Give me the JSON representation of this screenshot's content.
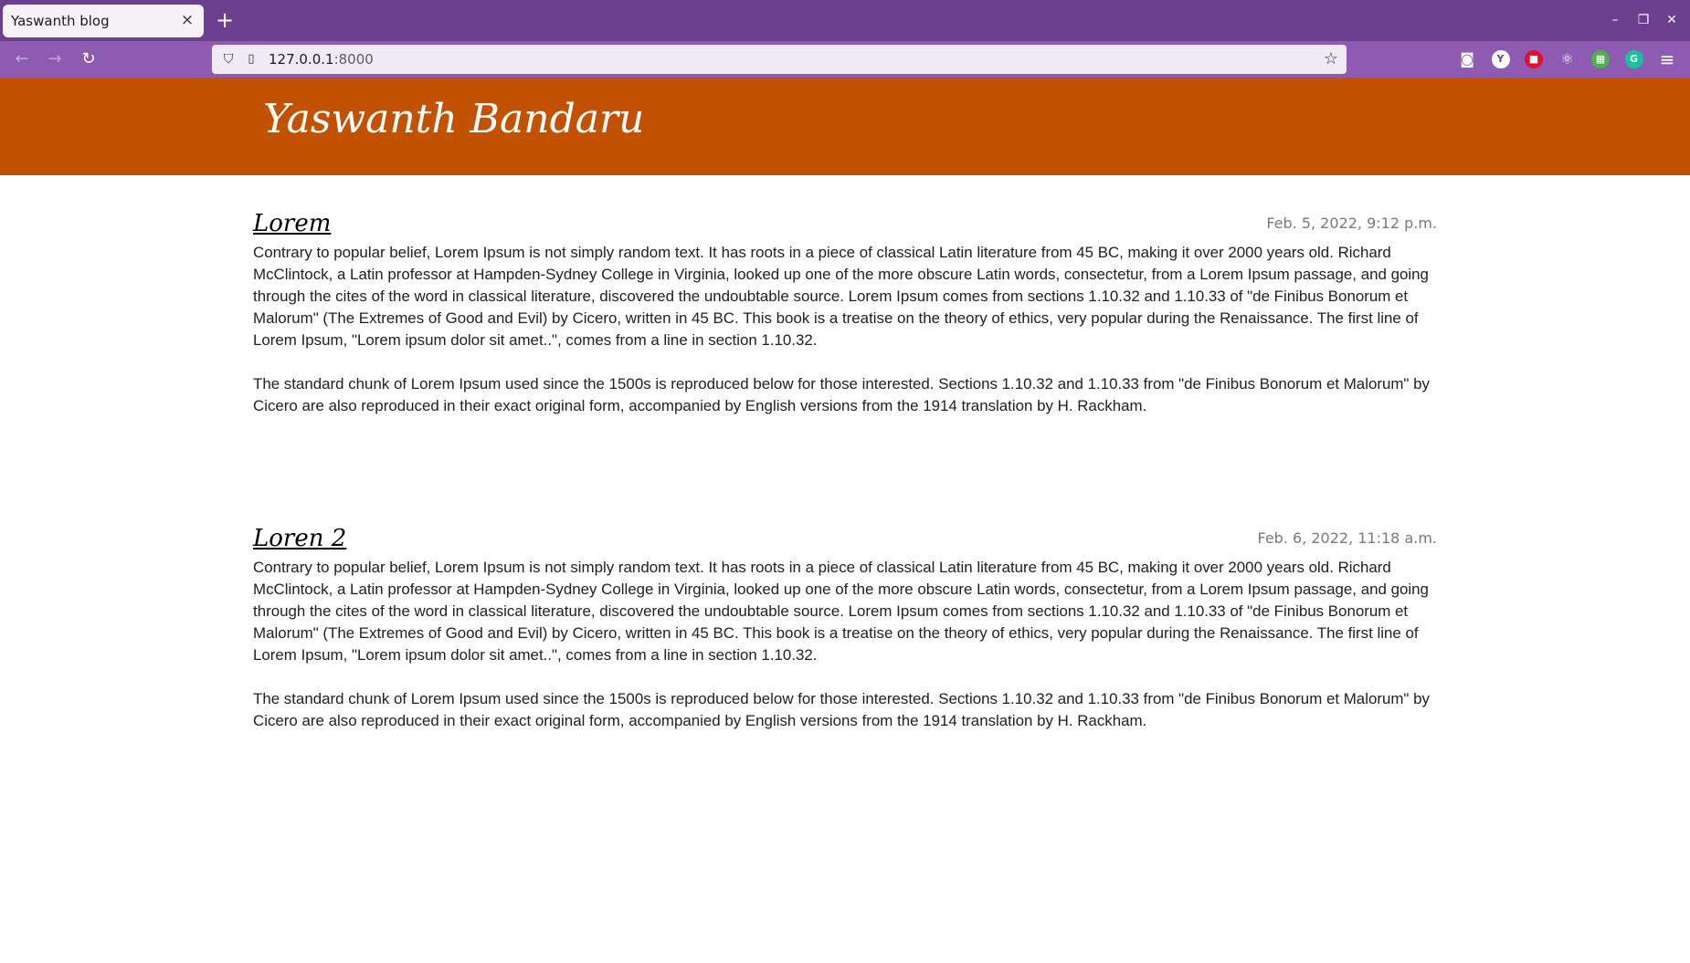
{
  "browser": {
    "tab_title": "Yaswanth blog",
    "tab_close": "×",
    "new_tab": "+",
    "url_host": "127.0.0.1",
    "url_port": ":8000",
    "nav_back": "←",
    "nav_forward": "→",
    "nav_reload": "↻",
    "star": "☆",
    "win_minimize": "–",
    "win_restore": "❐",
    "win_close": "✕",
    "menu": "≡",
    "extensions": [
      {
        "name": "pocket-icon",
        "glyph": "◙",
        "bg": "transparent"
      },
      {
        "name": "yoroi-icon",
        "glyph": "Y",
        "bg": "#ffffff"
      },
      {
        "name": "adblock-icon",
        "glyph": "■",
        "bg": "#e0102d"
      },
      {
        "name": "react-devtools-icon",
        "glyph": "⚛",
        "bg": "transparent"
      },
      {
        "name": "sheets-extension-icon",
        "glyph": "▦",
        "bg": "#4caf50"
      },
      {
        "name": "grammarly-icon",
        "glyph": "G",
        "bg": "#15c39a"
      }
    ]
  },
  "colors": {
    "tabbar": "#6b3f8e",
    "navbar": "#8e5ab2",
    "header": "#c25200"
  },
  "site": {
    "title": "Yaswanth Bandaru"
  },
  "posts": [
    {
      "title": "Lorem",
      "date": "Feb. 5, 2022, 9:12 p.m.",
      "paragraphs": [
        "Contrary to popular belief, Lorem Ipsum is not simply random text. It has roots in a piece of classical Latin literature from 45 BC, making it over 2000 years old. Richard McClintock, a Latin professor at Hampden-Sydney College in Virginia, looked up one of the more obscure Latin words, consectetur, from a Lorem Ipsum passage, and going through the cites of the word in classical literature, discovered the undoubtable source. Lorem Ipsum comes from sections 1.10.32 and 1.10.33 of \"de Finibus Bonorum et Malorum\" (The Extremes of Good and Evil) by Cicero, written in 45 BC. This book is a treatise on the theory of ethics, very popular during the Renaissance. The first line of Lorem Ipsum, \"Lorem ipsum dolor sit amet..\", comes from a line in section 1.10.32.",
        "The standard chunk of Lorem Ipsum used since the 1500s is reproduced below for those interested. Sections 1.10.32 and 1.10.33 from \"de Finibus Bonorum et Malorum\" by Cicero are also reproduced in their exact original form, accompanied by English versions from the 1914 translation by H. Rackham."
      ]
    },
    {
      "title": "Loren 2",
      "date": "Feb. 6, 2022, 11:18 a.m.",
      "paragraphs": [
        "Contrary to popular belief, Lorem Ipsum is not simply random text. It has roots in a piece of classical Latin literature from 45 BC, making it over 2000 years old. Richard McClintock, a Latin professor at Hampden-Sydney College in Virginia, looked up one of the more obscure Latin words, consectetur, from a Lorem Ipsum passage, and going through the cites of the word in classical literature, discovered the undoubtable source. Lorem Ipsum comes from sections 1.10.32 and 1.10.33 of \"de Finibus Bonorum et Malorum\" (The Extremes of Good and Evil) by Cicero, written in 45 BC. This book is a treatise on the theory of ethics, very popular during the Renaissance. The first line of Lorem Ipsum, \"Lorem ipsum dolor sit amet..\", comes from a line in section 1.10.32.",
        "The standard chunk of Lorem Ipsum used since the 1500s is reproduced below for those interested. Sections 1.10.32 and 1.10.33 from \"de Finibus Bonorum et Malorum\" by Cicero are also reproduced in their exact original form, accompanied by English versions from the 1914 translation by H. Rackham."
      ]
    }
  ]
}
